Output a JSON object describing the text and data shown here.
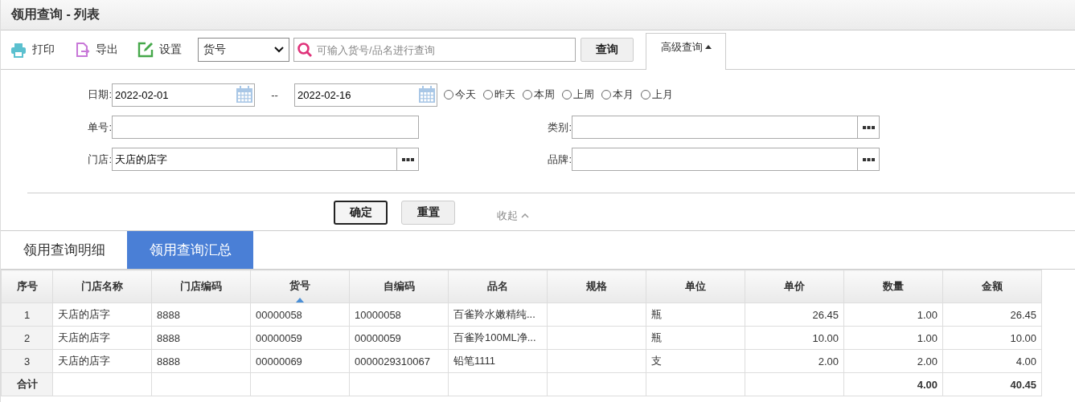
{
  "window": {
    "title": "领用查询 - 列表"
  },
  "toolbar": {
    "actions": [
      {
        "kind": "print",
        "label": "打印"
      },
      {
        "kind": "export",
        "label": "导出"
      },
      {
        "kind": "settings",
        "label": "设置"
      }
    ],
    "field_select": {
      "value": "货号"
    },
    "search": {
      "placeholder": "可输入货号/品名进行查询"
    },
    "query_button": "查询",
    "advanced": {
      "label": "高级查询",
      "expanded": true
    }
  },
  "filters": {
    "date_label": "日期:",
    "date_from": "2022-02-01",
    "date_sep": "--",
    "date_to": "2022-02-16",
    "ranges": [
      {
        "label": "今天",
        "selected": false
      },
      {
        "label": "昨天",
        "selected": false
      },
      {
        "label": "本周",
        "selected": false
      },
      {
        "label": "上周",
        "selected": false
      },
      {
        "label": "本月",
        "selected": false
      },
      {
        "label": "上月",
        "selected": false
      }
    ],
    "fields": [
      {
        "label": "单号:",
        "picker": false
      },
      {
        "label": "类别:",
        "picker": true
      },
      {
        "label": "门店:",
        "value": "天店的店字",
        "picker": true
      },
      {
        "label": "品牌:",
        "picker": true
      }
    ],
    "confirm": "确定",
    "reset": "重置",
    "collapse": "收起"
  },
  "tabs": [
    {
      "label": "领用查询明细",
      "selected": false
    },
    {
      "label": "领用查询汇总",
      "selected": true
    }
  ],
  "table": {
    "columns": [
      {
        "label": "序号",
        "sorted": false
      },
      {
        "label": "门店名称",
        "sorted": false
      },
      {
        "label": "门店编码",
        "sorted": false
      },
      {
        "label": "货号",
        "sorted": true
      },
      {
        "label": "自编码",
        "sorted": false
      },
      {
        "label": "品名",
        "sorted": false
      },
      {
        "label": "规格",
        "sorted": false
      },
      {
        "label": "单位",
        "sorted": false
      },
      {
        "label": "单价",
        "sorted": false
      },
      {
        "label": "数量",
        "sorted": false
      },
      {
        "label": "金额",
        "sorted": false
      }
    ],
    "rows": [
      [
        "1",
        "天店的店字",
        "8888",
        "00000058",
        "10000058",
        "百雀羚水嫩精纯...",
        "",
        "瓶",
        "26.45",
        "1.00",
        "26.45"
      ],
      [
        "2",
        "天店的店字",
        "8888",
        "00000059",
        "00000059",
        "百雀羚100ML净...",
        "",
        "瓶",
        "10.00",
        "1.00",
        "10.00"
      ],
      [
        "3",
        "天店的店字",
        "8888",
        "00000069",
        "0000029310067",
        "铅笔1111",
        "",
        "支",
        "2.00",
        "2.00",
        "4.00"
      ]
    ],
    "totals": {
      "label": "合计",
      "quantity": "4.00",
      "amount": "40.45"
    }
  }
}
